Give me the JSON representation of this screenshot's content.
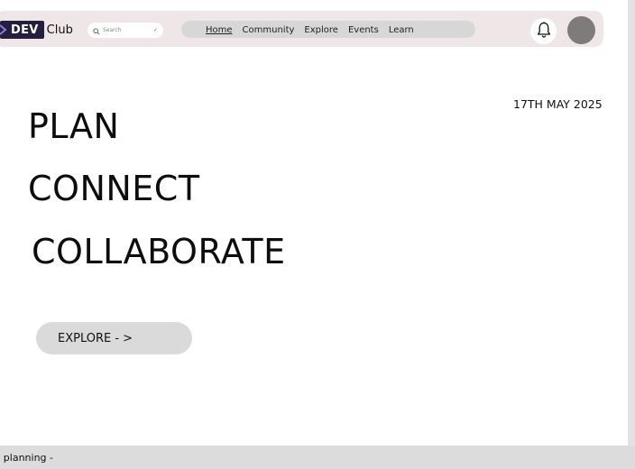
{
  "brand": {
    "logo_dev": "DEV",
    "logo_club": "Club",
    "logo_color": "#241f3f"
  },
  "search": {
    "placeholder": "Search",
    "icon": "search-icon"
  },
  "nav": {
    "items": [
      {
        "label": "Home",
        "active": true
      },
      {
        "label": "Community",
        "active": false
      },
      {
        "label": "Explore",
        "active": false
      },
      {
        "label": "Events",
        "active": false
      },
      {
        "label": "Learn",
        "active": false
      }
    ]
  },
  "header_actions": {
    "bell_icon": "bell-icon",
    "avatar_color": "#7f7b7b"
  },
  "date": "17TH MAY 2025",
  "hero": {
    "line1": "PLAN",
    "line2": "CONNECT",
    "line3": "COLLABORATE"
  },
  "cta": {
    "explore_label": "EXPLORE - >"
  },
  "footer": {
    "text": "t planning -"
  },
  "colors": {
    "navbar_bg": "#efe7e7",
    "nav_pill_bg": "#d7d7d7",
    "button_bg": "#dadada",
    "footer_bg": "#dcdcdc"
  }
}
